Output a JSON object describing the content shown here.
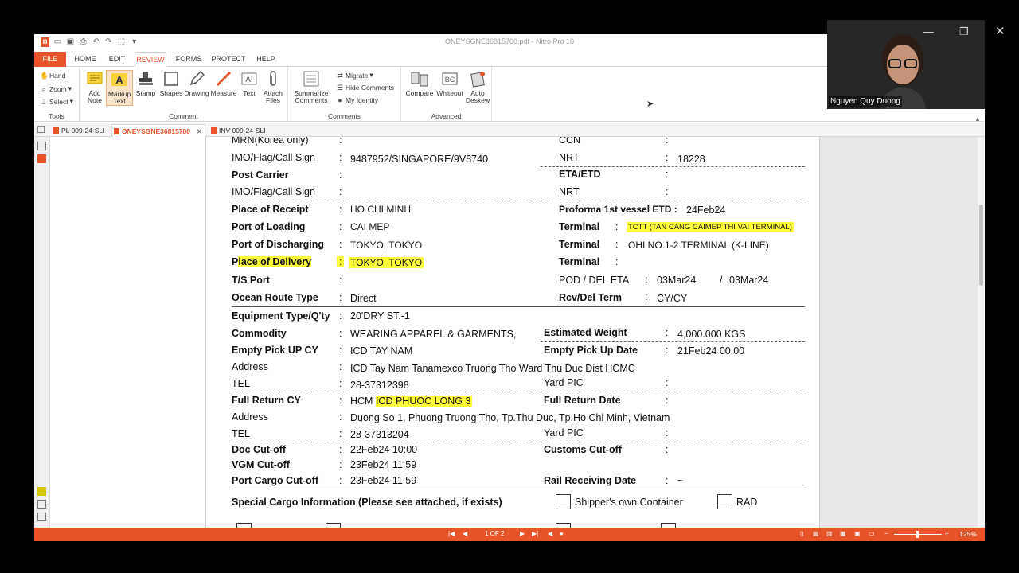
{
  "window": {
    "title": "ONEYSGNE36815700.pdf - Nitro Pro 10"
  },
  "ribbon_tabs": [
    "FILE",
    "HOME",
    "EDIT",
    "REVIEW",
    "FORMS",
    "PROTECT",
    "HELP"
  ],
  "tools_group": {
    "label": "Tools",
    "items": [
      "Hand",
      "Zoom",
      "Select"
    ]
  },
  "comment_group": {
    "label": "Comment",
    "items": [
      "Add Note",
      "Markup Text",
      "Stamp",
      "Shapes",
      "Drawing",
      "Measure",
      "Text",
      "Attach Files"
    ]
  },
  "comments_group": {
    "label": "Comments",
    "summarize": "Summarize Comments",
    "migrate": "Migrate",
    "hide": "Hide Comments",
    "identity": "My Identity"
  },
  "advanced_group": {
    "label": "Advanced",
    "items": [
      "Compare",
      "Whiteout",
      "Auto Deskew"
    ]
  },
  "doc_tabs": [
    "PL 009-24-SLI",
    "ONEYSGNE36815700",
    "INV 009-24-SLI"
  ],
  "doc": {
    "mrn_label": "MRN(Korea only)",
    "ccn_label": "CCN",
    "imo_label": "IMO/Flag/Call Sign",
    "imo_value": "9487952/SINGAPORE/9V8740",
    "nrt_label": "NRT",
    "nrt_value": "18228",
    "post_carrier_label": "Post Carrier",
    "eta_etd_label": "ETA/ETD",
    "imo2_label": "IMO/Flag/Call Sign",
    "nrt2_label": "NRT",
    "receipt_label": "Place of Receipt",
    "receipt_value": "HO CHI MINH",
    "proforma_label": "Proforma 1st vessel ETD :",
    "proforma_value": "24Feb24",
    "loading_label": "Port of Loading",
    "loading_value": "CAI MEP",
    "terminal1_label": "Terminal",
    "terminal1_value": "TCTT (TAN CANG CAIMEP THI VAI TERMINAL)",
    "discharging_label": "Port of Discharging",
    "discharging_value": "TOKYO, TOKYO",
    "terminal2_label": "Terminal",
    "terminal2_value": "OHI NO.1-2 TERMINAL (K-LINE)",
    "delivery_label_p": "P",
    "delivery_label_rest": "lace of Delivery",
    "delivery_value": "TOKYO, TOKYO",
    "terminal3_label": "Terminal",
    "ts_label": "T/S Port",
    "pod_label": "POD / DEL ETA",
    "pod_value1": "03Mar24",
    "pod_slash": "/",
    "pod_value2": "03Mar24",
    "route_label": "Ocean Route Type",
    "route_value": "Direct",
    "rcv_label": "Rcv/Del Term",
    "rcv_value": "CY/CY",
    "equip_label": "Equipment Type/Q'ty",
    "equip_value": "20'DRY ST.-1",
    "commodity_label": "Commodity",
    "commodity_value": "WEARING APPAREL & GARMENTS,",
    "weight_label": "Estimated Weight",
    "weight_value": "4,000.000 KGS",
    "empty_cy_label": "Empty Pick UP CY",
    "empty_cy_value": "ICD TAY NAM",
    "empty_date_label": "Empty Pick Up Date",
    "empty_date_value": "21Feb24 00:00",
    "address1_label": "Address",
    "address1_value": "ICD Tay Nam  Tanamexco  Truong Tho Ward  Thu Duc Dist  HCMC",
    "tel1_label": "TEL",
    "tel1_value": "28-37312398",
    "yard1_label": "Yard PIC",
    "return_cy_label": "Full Return CY",
    "return_cy_prefix": "HCM ",
    "return_cy_value": "ICD PHUOC LONG 3",
    "return_date_label": "Full Return Date",
    "address2_label": "Address",
    "address2_value": "Duong So 1, Phuong Truong Tho, Tp.Thu Duc, Tp.Ho Chi Minh, Vietnam",
    "tel2_label": "TEL",
    "tel2_value": "28-37313204",
    "yard2_label": "Yard PIC",
    "doc_cutoff_label": "Doc Cut-off",
    "doc_cutoff_value": "22Feb24 10:00",
    "customs_label": "Customs Cut-off",
    "vgm_label": "VGM Cut-off",
    "vgm_value": "23Feb24 11:59",
    "port_cargo_label": "Port Cargo Cut-off",
    "port_cargo_value": "23Feb24 11:59",
    "rail_label": "Rail Receiving Date",
    "rail_value": "~",
    "special_label": "Special Cargo Information (Please see attached, if exists)",
    "shipper_container": "Shipper's own Container",
    "rad": "RAD",
    "colon": ":"
  },
  "status": {
    "page": "1 OF 2",
    "zoom": "125%"
  },
  "webcam": {
    "name": "Nguyen Quy Duong"
  },
  "colors": {
    "accent": "#e8542a",
    "highlight": "#ffff3a"
  }
}
